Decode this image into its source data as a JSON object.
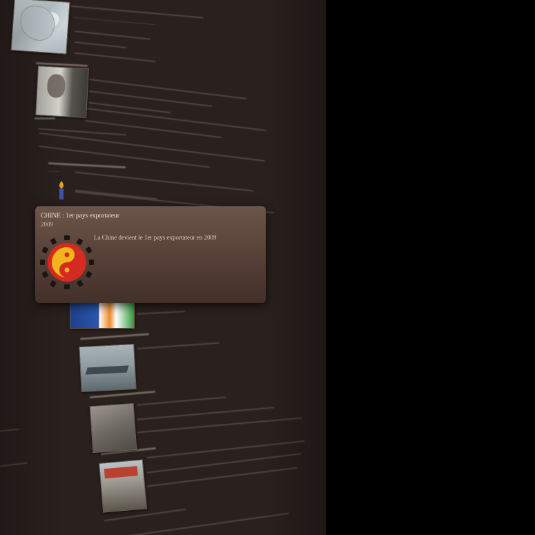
{
  "event": {
    "title": "CHINE : 1er pays exportateur",
    "year": "2009",
    "description": "La Chine devient le 1er pays exportateur en 2009",
    "emblem_icon": "yin-yang-emblem-icon"
  },
  "timeline_thumbnails": [
    {
      "icon": "map-thumbnail-icon"
    },
    {
      "icon": "portrait-thumbnail-icon"
    },
    {
      "icon": "torch-icon"
    },
    {
      "icon": "flag-banner-thumbnail-icon"
    },
    {
      "icon": "aircraft-carrier-thumbnail-icon"
    },
    {
      "icon": "crowd-thumbnail-icon"
    },
    {
      "icon": "street-protest-thumbnail-icon"
    }
  ],
  "colors": {
    "panel_background": "#2a211e",
    "card_top": "#6b554a",
    "card_bottom": "#42302a",
    "outside_background": "#000000",
    "emblem_red": "#d42a22",
    "emblem_yellow": "#f2b51c"
  }
}
